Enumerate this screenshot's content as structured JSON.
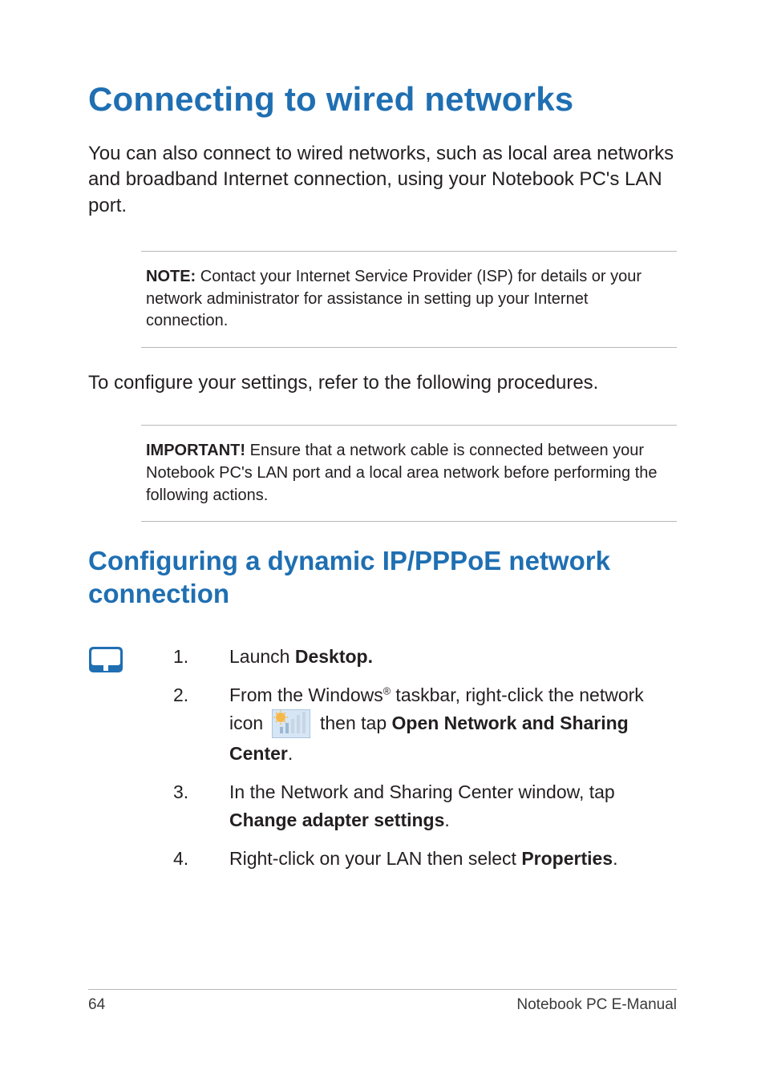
{
  "heading": "Connecting to wired networks",
  "intro": "You can also connect to wired networks, such as local area networks and broadband Internet connection, using your Notebook PC's LAN port.",
  "note": {
    "label": "NOTE:",
    "text": " Contact your Internet Service Provider (ISP) for details or your network administrator for assistance in setting up your Internet connection."
  },
  "mid": "To configure your settings, refer to the following procedures.",
  "important": {
    "label": "IMPORTANT!",
    "text": "  Ensure that a network cable is connected between your Notebook PC's LAN port and a local area network before performing the following actions."
  },
  "subheading": "Configuring a dynamic IP/PPPoE network connection",
  "steps": [
    {
      "n": "1.",
      "pre": "Launch ",
      "b1": "Desktop.",
      "post": ""
    },
    {
      "n": "2.",
      "pre": "From the Windows",
      "sup": "®",
      "mid": " taskbar, right-click the network icon ",
      "post1": " then tap ",
      "b1": "Open Network and Sharing Center",
      "post2": "."
    },
    {
      "n": "3.",
      "pre": "In the Network and Sharing Center window, tap ",
      "b1": "Change adapter settings",
      "post": "."
    },
    {
      "n": "4.",
      "pre": "Right-click on your LAN then select ",
      "b1": "Properties",
      "post": "."
    }
  ],
  "footer": {
    "page": "64",
    "title": "Notebook PC E-Manual"
  }
}
